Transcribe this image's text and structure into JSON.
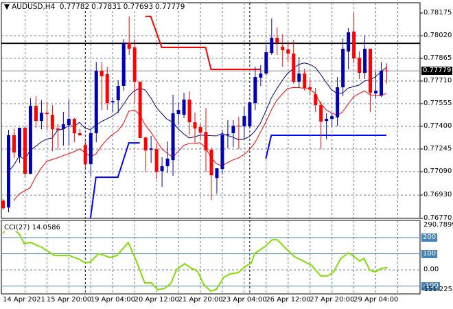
{
  "header": {
    "symbol": "AUDUSD,H4",
    "open": "0.77782",
    "high": "0.77831",
    "low": "0.77693",
    "close": "0.77779"
  },
  "colors": {
    "bull": "#0000b4",
    "bear": "#ff0000",
    "ma_fast": "#000080",
    "ma_slow": "#ff0000",
    "cci": "#7fe000",
    "level": "#4682b4",
    "grid": "#708090"
  },
  "chart_data": [
    {
      "type": "candlestick",
      "title": "AUDUSD,H4",
      "ylim": [
        0.7677,
        0.78175
      ],
      "price_ticks": [
        "0.78175",
        "0.78020",
        "0.77865",
        "0.77710",
        "0.77555",
        "0.77400",
        "0.77245",
        "0.77090",
        "0.76930",
        "0.76770"
      ],
      "current_price": "0.77779",
      "resistance_line": 0.77968,
      "x_labels": [
        "14 Apr 2021",
        "15 Apr 20:00",
        "19 Apr 04:00",
        "20 Apr 12:00",
        "21 Apr 20:00",
        "23 Apr 04:00",
        "26 Apr 12:00",
        "27 Apr 20:00",
        "29 Apr 04:00"
      ],
      "period_separators": [
        15,
        45
      ],
      "ohlc": [
        [
          0.76892,
          0.76901,
          0.76831,
          0.7684
        ],
        [
          0.76845,
          0.77376,
          0.76812,
          0.77339
        ],
        [
          0.77339,
          0.77385,
          0.77183,
          0.77221
        ],
        [
          0.77193,
          0.7739,
          0.7715,
          0.7739
        ],
        [
          0.7739,
          0.77404,
          0.77052,
          0.77075
        ],
        [
          0.77075,
          0.77592,
          0.77075,
          0.7754
        ],
        [
          0.7754,
          0.77606,
          0.7739,
          0.77437
        ],
        [
          0.77437,
          0.77578,
          0.77381,
          0.77493
        ],
        [
          0.77493,
          0.77569,
          0.77376,
          0.77484
        ],
        [
          0.77479,
          0.77545,
          0.7723,
          0.77381
        ],
        [
          0.77385,
          0.77418,
          0.7724,
          0.77376
        ],
        [
          0.77381,
          0.77498,
          0.77268,
          0.77414
        ],
        [
          0.77409,
          0.77583,
          0.77268,
          0.77451
        ],
        [
          0.77451,
          0.77456,
          0.77291,
          0.77353
        ],
        [
          0.77353,
          0.77381,
          0.77334,
          0.77339
        ],
        [
          0.77273,
          0.7731,
          0.77118,
          0.77141
        ],
        [
          0.77141,
          0.77376,
          0.77061,
          0.77353
        ],
        [
          0.77353,
          0.77841,
          0.77291,
          0.7778
        ],
        [
          0.7778,
          0.77841,
          0.77512,
          0.77743
        ],
        [
          0.77757,
          0.77804,
          0.77512,
          0.77559
        ],
        [
          0.77564,
          0.77597,
          0.77493,
          0.77573
        ],
        [
          0.77578,
          0.77714,
          0.77489,
          0.77677
        ],
        [
          0.77677,
          0.77996,
          0.77644,
          0.77968
        ],
        [
          0.77968,
          0.78152,
          0.77888,
          0.77931
        ],
        [
          0.7794,
          0.77996,
          0.77559,
          0.77705
        ],
        [
          0.77705,
          0.77705,
          0.7732,
          0.7732
        ],
        [
          0.77324,
          0.77329,
          0.77089,
          0.77235
        ],
        [
          0.7724,
          0.77334,
          0.7715,
          0.77249
        ],
        [
          0.77244,
          0.77282,
          0.77038,
          0.77089
        ],
        [
          0.77094,
          0.77188,
          0.76986,
          0.77127
        ],
        [
          0.77127,
          0.77296,
          0.7708,
          0.77179
        ],
        [
          0.77169,
          0.77616,
          0.77061,
          0.77489
        ],
        [
          0.77484,
          0.77564,
          0.77409,
          0.77512
        ],
        [
          0.77479,
          0.7763,
          0.77456,
          0.77583
        ],
        [
          0.77583,
          0.77639,
          0.77343,
          0.77428
        ],
        [
          0.77428,
          0.77494,
          0.77287,
          0.77385
        ],
        [
          0.77395,
          0.77418,
          0.7731,
          0.77357
        ],
        [
          0.77362,
          0.77526,
          0.77089,
          0.77235
        ],
        [
          0.7724,
          0.77254,
          0.76897,
          0.77066
        ],
        [
          0.77047,
          0.77113,
          0.76939,
          0.77113
        ],
        [
          0.77108,
          0.77376,
          0.7707,
          0.77343
        ],
        [
          0.77343,
          0.77442,
          0.77249,
          0.77348
        ],
        [
          0.77353,
          0.77442,
          0.77258,
          0.77404
        ],
        [
          0.77404,
          0.77465,
          0.77244,
          0.774
        ],
        [
          0.774,
          0.77536,
          0.77315,
          0.7747
        ],
        [
          0.774,
          0.77564,
          0.77385,
          0.77564
        ],
        [
          0.77559,
          0.77808,
          0.77512,
          0.77738
        ],
        [
          0.77733,
          0.77818,
          0.77677,
          0.77761
        ],
        [
          0.77761,
          0.77954,
          0.77747,
          0.77907
        ],
        [
          0.77902,
          0.78137,
          0.77888,
          0.78006
        ],
        [
          0.78006,
          0.78076,
          0.77888,
          0.77973
        ],
        [
          0.77945,
          0.78029,
          0.77808,
          0.77921
        ],
        [
          0.77926,
          0.77982,
          0.77841,
          0.77898
        ],
        [
          0.77898,
          0.77992,
          0.77691,
          0.77705
        ],
        [
          0.77705,
          0.77874,
          0.77663,
          0.77761
        ],
        [
          0.77761,
          0.77794,
          0.77644,
          0.77663
        ],
        [
          0.77667,
          0.77724,
          0.77616,
          0.77653
        ],
        [
          0.7762,
          0.77663,
          0.77498,
          0.77545
        ],
        [
          0.77545,
          0.77569,
          0.77244,
          0.77432
        ],
        [
          0.77437,
          0.77489,
          0.7731,
          0.77451
        ],
        [
          0.77451,
          0.77489,
          0.774,
          0.7747
        ],
        [
          0.77461,
          0.77738,
          0.774,
          0.77667
        ],
        [
          0.77667,
          0.78001,
          0.77606,
          0.77931
        ],
        [
          0.77912,
          0.78072,
          0.7779,
          0.78043
        ],
        [
          0.78048,
          0.78175,
          0.77832,
          0.77865
        ],
        [
          0.77869,
          0.77912,
          0.77724,
          0.77766
        ],
        [
          0.77766,
          0.7802,
          0.77724,
          0.77931
        ],
        [
          0.77931,
          0.77931,
          0.77498,
          0.7763
        ],
        [
          0.77625,
          0.77775,
          0.77592,
          0.77644
        ],
        [
          0.77611,
          0.77841,
          0.77602,
          0.7778
        ],
        [
          0.77782,
          0.77831,
          0.77693,
          0.77779
        ]
      ],
      "red_step_line": [
        [
          26,
          0.78152
        ],
        [
          27,
          0.78152
        ],
        [
          29,
          0.7794
        ],
        [
          37,
          0.7794
        ],
        [
          38,
          0.7779
        ],
        [
          47,
          0.7779
        ]
      ],
      "blue_step_lines": [
        [
          [
            16,
            0.7677
          ],
          [
            17,
            0.77052
          ],
          [
            21,
            0.77052
          ],
          [
            23,
            0.77287
          ],
          [
            25,
            0.77287
          ]
        ],
        [
          [
            48,
            0.77179
          ],
          [
            49,
            0.77339
          ],
          [
            70,
            0.77339
          ]
        ]
      ]
    },
    {
      "type": "line",
      "title": "CCI(27)",
      "value_label": "14.0586",
      "ylim": [
        -151.2252,
        290.7899
      ],
      "ymax_label": "290.7899",
      "ymin_label": "-151.2252",
      "levels": [
        {
          "value": 200,
          "label": "200"
        },
        {
          "value": 100,
          "label": "100"
        },
        {
          "value": 0,
          "label": "0.00"
        },
        {
          "value": -100,
          "label": "-100"
        }
      ],
      "points": [
        [
          0,
          225
        ],
        [
          1.08,
          268
        ],
        [
          2.98,
          225
        ],
        [
          3.93,
          162
        ],
        [
          5.03,
          170
        ],
        [
          7.09,
          140
        ],
        [
          9.46,
          89
        ],
        [
          12.15,
          89
        ],
        [
          14.05,
          64
        ],
        [
          15,
          43
        ],
        [
          15.94,
          47
        ],
        [
          17.52,
          102
        ],
        [
          18.16,
          94
        ],
        [
          19.58,
          77
        ],
        [
          20.84,
          89
        ],
        [
          22.9,
          170
        ],
        [
          24.48,
          47
        ],
        [
          25.9,
          -81
        ],
        [
          27.17,
          -81
        ],
        [
          28.27,
          -123
        ],
        [
          29.54,
          -115
        ],
        [
          30.65,
          -85
        ],
        [
          31.75,
          4
        ],
        [
          33.18,
          38
        ],
        [
          34.28,
          13
        ],
        [
          35.55,
          -9
        ],
        [
          36.65,
          -89
        ],
        [
          37.92,
          -132
        ],
        [
          39.03,
          -119
        ],
        [
          40.29,
          -47
        ],
        [
          41.4,
          -26
        ],
        [
          42.98,
          -17
        ],
        [
          44.24,
          21
        ],
        [
          45.35,
          43
        ],
        [
          45.98,
          102
        ],
        [
          47.88,
          145
        ],
        [
          49.14,
          187
        ],
        [
          50.09,
          187
        ],
        [
          51.67,
          132
        ],
        [
          53.25,
          81
        ],
        [
          54.84,
          55
        ],
        [
          56.42,
          26
        ],
        [
          58,
          -38
        ],
        [
          59.26,
          -38
        ],
        [
          60.37,
          -13
        ],
        [
          61.63,
          68
        ],
        [
          63.06,
          106
        ],
        [
          64.16,
          81
        ],
        [
          65.11,
          55
        ],
        [
          65.9,
          72
        ],
        [
          67,
          -4
        ],
        [
          67.96,
          -13
        ],
        [
          69.06,
          9
        ],
        [
          70.17,
          14
        ]
      ]
    }
  ]
}
